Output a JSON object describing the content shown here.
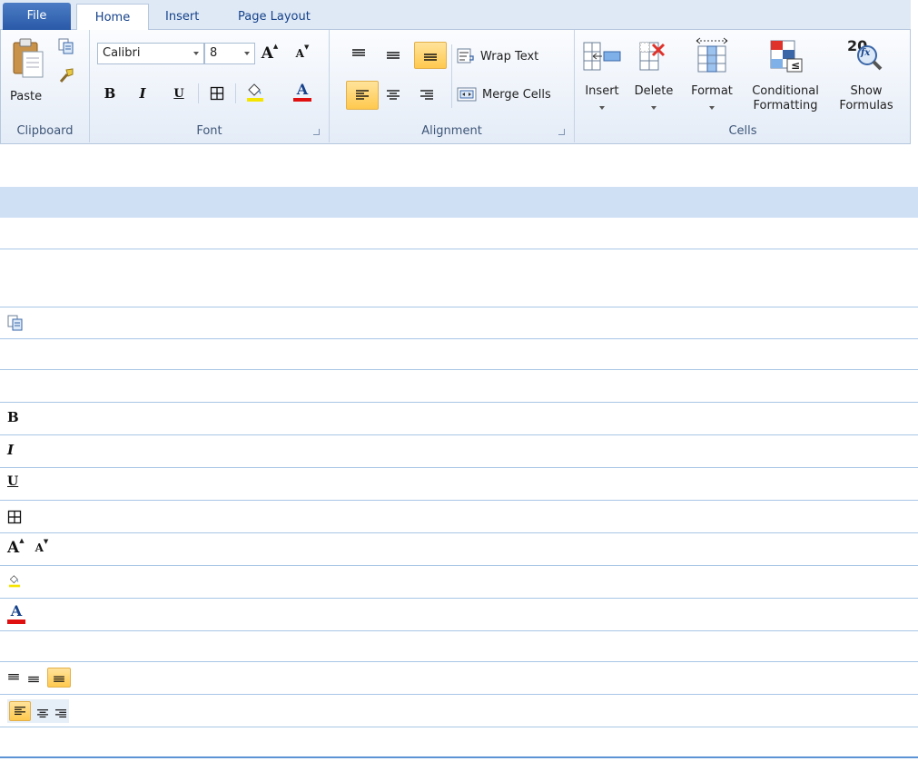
{
  "tabs": {
    "file": "File",
    "home": "Home",
    "insert": "Insert",
    "page_layout": "Page Layout"
  },
  "clipboard": {
    "paste": "Paste",
    "group_label": "Clipboard"
  },
  "font": {
    "family": "Calibri",
    "size": "8",
    "group_label": "Font"
  },
  "alignment": {
    "wrap_text": "Wrap Text",
    "merge_cells": "Merge Cells",
    "group_label": "Alignment"
  },
  "cells": {
    "insert": "Insert",
    "delete": "Delete",
    "format": "Format",
    "conditional_line1": "Conditional",
    "conditional_line2": "Formatting",
    "show_line1": "Show",
    "show_line2": "Formulas",
    "group_label": "Cells"
  },
  "colors": {
    "accent": "#2a5aa8",
    "ribbon_bg": "#e4ecf7",
    "active_button": "#ffc94e",
    "row_line": "#a8c6e6",
    "header_bg": "#cfe0f5",
    "font_color_bar": "#e01010",
    "highlight_bar": "#f5e400"
  },
  "list_rows": [
    {
      "icon": ""
    },
    {
      "icon": ""
    },
    {
      "icon": "copy-icon"
    },
    {
      "icon": ""
    },
    {
      "icon": ""
    },
    {
      "icon": "bold-icon"
    },
    {
      "icon": "italic-icon"
    },
    {
      "icon": "underline-icon"
    },
    {
      "icon": "borders-icon"
    },
    {
      "icon": "font-size-icons"
    },
    {
      "icon": "fill-color-icon"
    },
    {
      "icon": "font-color-icon"
    },
    {
      "icon": ""
    },
    {
      "icon": "vertical-align-icons"
    },
    {
      "icon": "horizontal-align-icons"
    }
  ],
  "glyphs": {
    "bold": "B",
    "italic": "I",
    "underline": "U",
    "grow": "A",
    "shrink": "A",
    "font_color": "A",
    "show_formulas_num": "20",
    "show_formulas_fx": "fx",
    "cond_sign": "≤"
  }
}
